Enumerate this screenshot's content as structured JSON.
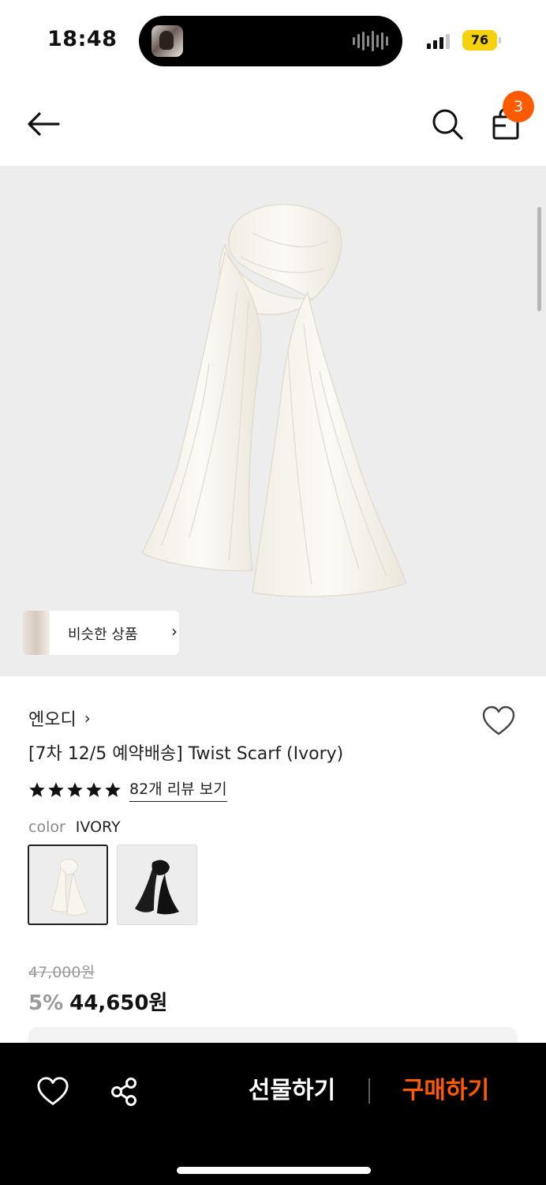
{
  "status_bar": {
    "time": "18:48",
    "battery": "76"
  },
  "nav": {
    "cart_count": "3"
  },
  "hero": {
    "similar_label": "비슷한 상품",
    "similar_chevron": "›"
  },
  "product": {
    "brand": "엔오디",
    "brand_chevron": "›",
    "title": "[7차 12/5 예약배송] Twist Scarf (Ivory)",
    "rating_stars": 5,
    "review_link": "82개 리뷰 보기",
    "color_label": "color",
    "color_value": "IVORY",
    "original_price": "47,000원",
    "discount_rate": "5%",
    "sale_price": "44,650원"
  },
  "bottom_bar": {
    "gift_label": "선물하기",
    "buy_label": "구매하기"
  },
  "colors": {
    "accent": "#ff5a00",
    "hero_bg": "#ededed",
    "bar_bg": "#000000"
  }
}
